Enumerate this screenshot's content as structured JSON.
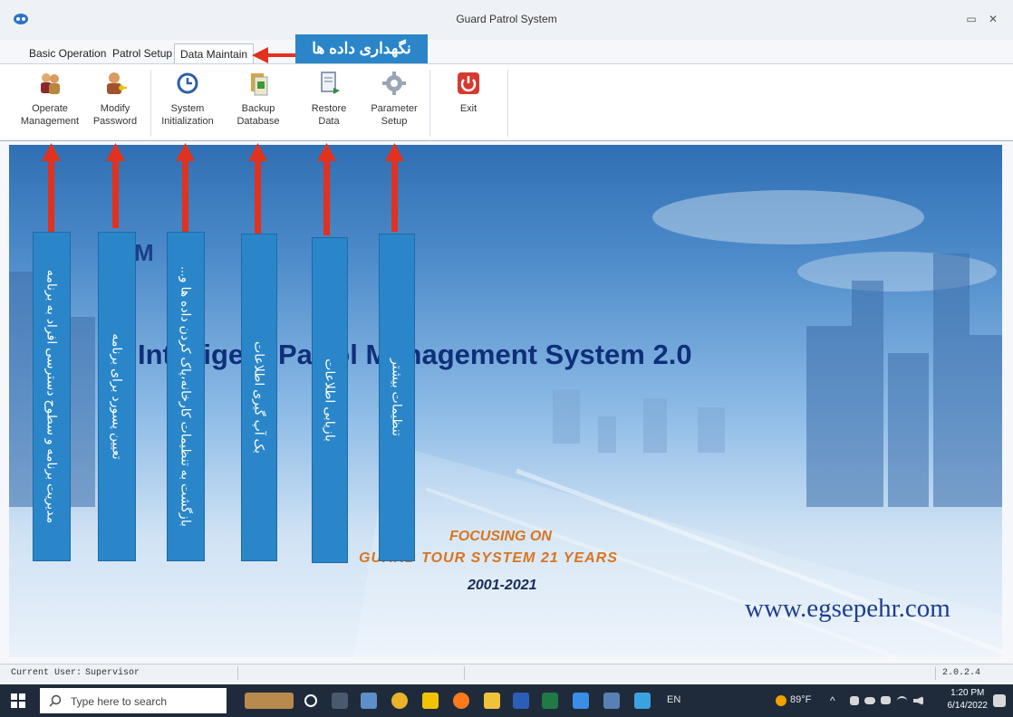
{
  "window": {
    "title": "Guard Patrol System"
  },
  "tabs": [
    {
      "label": "Basic Operation"
    },
    {
      "label": "Patrol Setup"
    },
    {
      "label": "Data Maintain"
    }
  ],
  "callout": {
    "tab_note": "نگهداری داده ها"
  },
  "ribbon": {
    "buttons": [
      {
        "label": "Operate\nManagement"
      },
      {
        "label": "Modify\nPassword"
      },
      {
        "label": "System\nInitialization"
      },
      {
        "label": "Backup\nDatabase"
      },
      {
        "label": "Restore\nData"
      },
      {
        "label": "Parameter\nSetup"
      },
      {
        "label": "Exit"
      }
    ]
  },
  "annotations": [
    {
      "text": "مدیریت برنامه و سطوح دسترسی افراد به برنامه"
    },
    {
      "text": "تعیین پسورد برای برنامه"
    },
    {
      "text": "بازگشت به تنظیمات کارخانه،پاک کردن داده ها و..."
    },
    {
      "text": "بک آپ گیری اطلاعات"
    },
    {
      "text": "بازیابی اطلاعات"
    },
    {
      "text": "تنظیمات بیشتر"
    }
  ],
  "banner": {
    "logo_text": "M",
    "title": "Intelligent Patrol Management System 2.0",
    "focus_line1": "FOCUSING ON",
    "focus_line2": "GUARD TOUR SYSTEM 21 YEARS",
    "years": "2001-2021",
    "website": "www.egsepehr.com"
  },
  "status": {
    "user_label": "Current User:",
    "user_value": "Supervisor",
    "version": "2.0.2.4"
  },
  "taskbar": {
    "search_placeholder": "Type here to search",
    "lang": "EN",
    "weather": "89°F",
    "time": "1:20 PM",
    "date": "6/14/2022"
  },
  "colors": {
    "annotation_box": "#2a86c8",
    "arrow": "#e0321e",
    "title_text": "#0f2f7a",
    "accent_orange": "#d9741f"
  }
}
